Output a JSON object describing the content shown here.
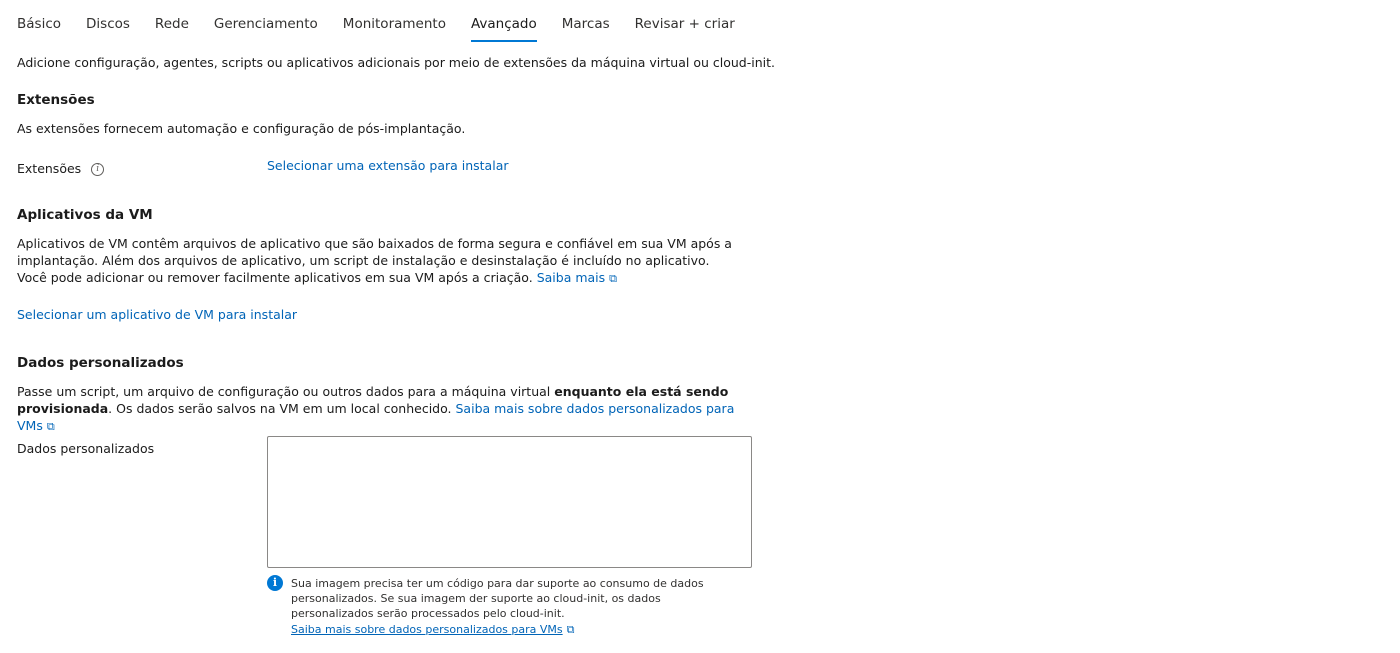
{
  "tabs": [
    {
      "label": "Básico",
      "active": false
    },
    {
      "label": "Discos",
      "active": false
    },
    {
      "label": "Rede",
      "active": false
    },
    {
      "label": "Gerenciamento",
      "active": false
    },
    {
      "label": "Monitoramento",
      "active": false
    },
    {
      "label": "Avançado",
      "active": true
    },
    {
      "label": "Marcas",
      "active": false
    },
    {
      "label": "Revisar + criar",
      "active": false
    }
  ],
  "intro": "Adicione configuração, agentes, scripts ou aplicativos adicionais por meio de extensões da máquina virtual ou cloud-init.",
  "extensions": {
    "title": "Extensões",
    "description": "As extensões fornecem automação e configuração de pós-implantação.",
    "field_label": "Extensões",
    "select_link": "Selecionar uma extensão para instalar"
  },
  "vm_apps": {
    "title": "Aplicativos da VM",
    "description": "Aplicativos de VM contêm arquivos de aplicativo que são baixados de forma segura e confiável em sua VM após a implantação. Além dos arquivos de aplicativo, um script de instalação e desinstalação é incluído no aplicativo. Você pode adicionar ou remover facilmente aplicativos em sua VM após a criação.",
    "learn_more": "Saiba mais",
    "select_link": "Selecionar um aplicativo de VM para instalar"
  },
  "custom_data": {
    "title": "Dados personalizados",
    "description_prefix": "Passe um script, um arquivo de configuração ou outros dados para a máquina virtual ",
    "description_bold": "enquanto ela está sendo provisionada",
    "description_suffix": ". Os dados serão salvos na VM em um local conhecido. ",
    "learn_more": "Saiba mais sobre dados personalizados para VMs",
    "field_label": "Dados personalizados",
    "textarea_value": "",
    "info_text": "Sua imagem precisa ter um código para dar suporte ao consumo de dados personalizados. Se sua imagem der suporte ao cloud-init, os dados personalizados serão processados pelo cloud-init.",
    "info_link": "Saiba mais sobre dados personalizados para VMs"
  },
  "icons": {
    "info": "info-icon",
    "external": "external-link-icon",
    "info_badge": "info-badge-icon"
  },
  "colors": {
    "accent": "#0078d4",
    "link": "#0064b7",
    "text": "#1b1b1b"
  }
}
